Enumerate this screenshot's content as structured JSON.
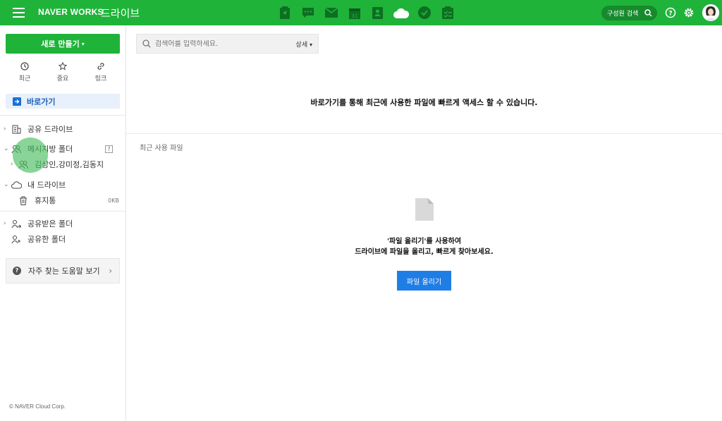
{
  "topbar": {
    "brand": "NAVER WORKS",
    "app_name": "드라이브",
    "search_label": "구성원 검색",
    "app_icons": [
      "board-icon",
      "message-icon",
      "mail-icon",
      "calendar-icon",
      "contacts-icon",
      "drive-icon",
      "task-icon",
      "form-icon"
    ],
    "calendar_day": "31",
    "bg_color": "#1fb339"
  },
  "sidebar": {
    "new_button": "새로 만들기",
    "quick": [
      {
        "label": "최근",
        "icon": "clock-icon"
      },
      {
        "label": "중요",
        "icon": "star-icon"
      },
      {
        "label": "링크",
        "icon": "link-icon"
      }
    ],
    "shortcut": "바로가기",
    "shared_drive": "공유 드라이브",
    "messenger_folder": "메시지방 폴더",
    "messenger_folder_badge": "?",
    "messenger_sub": "김상인,강미정,김동지",
    "my_drive": "내 드라이브",
    "trash": "휴지통",
    "trash_size": "0KB",
    "received_shared": "공유받은 폴더",
    "shared_by_me": "공유한 폴더",
    "help": "자주 찾는 도움말 보기",
    "copyright": "© NAVER Cloud Corp."
  },
  "main": {
    "search_placeholder": "검색어를 입력하세요.",
    "search_detail": "상세",
    "banner": "바로가기를 통해 최근에 사용한 파일에 빠르게 액세스 할 수 있습니다.",
    "recent_label": "최근 사용 파일",
    "empty_line1": "'파일 올리기'를 사용하여",
    "empty_line2": "드라이브에 파일을 올리고, 빠르게 찾아보세요.",
    "upload_button": "파일 올리기"
  }
}
